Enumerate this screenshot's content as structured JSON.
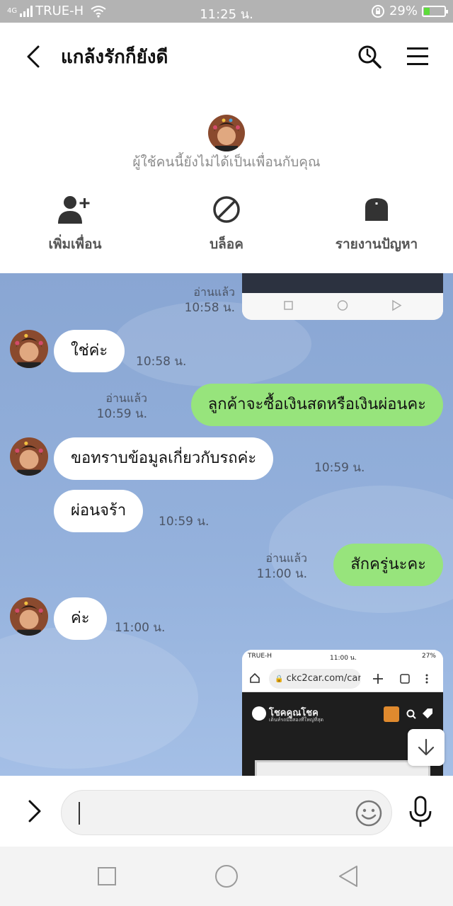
{
  "status_bar": {
    "network": "4G",
    "carrier": "TRUE-H",
    "time": "11:25 น.",
    "battery_percent": "29%",
    "battery_level": 0.29
  },
  "header": {
    "title": "แกล้งรักก็ยังดี",
    "icons": [
      "back-arrow-icon",
      "search-icon",
      "hamburger-menu-icon"
    ]
  },
  "profile": {
    "notice": "ผู้ใช้คนนี้ยังไม่ได้เป็นเพื่อนกับคุณ",
    "actions": [
      {
        "label": "เพิ่มเพื่อน",
        "icon": "add-friend-icon"
      },
      {
        "label": "บล็อค",
        "icon": "block-icon"
      },
      {
        "label": "รายงานปัญหา",
        "icon": "report-icon"
      }
    ]
  },
  "messages": [
    {
      "type": "image",
      "side": "right",
      "read": "อ่านแล้ว",
      "time": "10:58 น."
    },
    {
      "type": "text",
      "side": "left",
      "text": "ใช่ค่ะ",
      "time": "10:58 น."
    },
    {
      "type": "text",
      "side": "right",
      "text": "ลูกค้าจะซื้อเงินสดหรือเงินผ่อนคะ",
      "read": "อ่านแล้ว",
      "time": "10:59 น."
    },
    {
      "type": "text",
      "side": "left",
      "text": "ขอทราบข้อมูลเกี่ยวกับรถค่ะ",
      "time": "10:59 น."
    },
    {
      "type": "text",
      "side": "left",
      "text": "ผ่อนจร้า",
      "time": "10:59 น."
    },
    {
      "type": "text",
      "side": "right",
      "text": "สักครู่นะคะ",
      "read": "อ่านแล้ว",
      "time": "11:00 น."
    },
    {
      "type": "text",
      "side": "left",
      "text": "ค่ะ",
      "time": "11:00 น."
    },
    {
      "type": "image",
      "side": "right",
      "preview": {
        "carrier": "TRUE-H",
        "time": "11:00 น.",
        "battery": "27%",
        "url": "ckc2car.com/car",
        "site_logo": "โชคคูณโชค",
        "site_tagline": "เต็นท์รถมือสองที่ใหญ่ที่สุด"
      }
    }
  ],
  "input": {
    "value": "",
    "icons": [
      "chevron-right-icon",
      "emoji-icon",
      "microphone-icon"
    ]
  },
  "nav": [
    "recents-square-icon",
    "home-circle-icon",
    "back-triangle-icon"
  ],
  "colors": {
    "chat_bg": "#8ca9d6",
    "my_bubble": "#97e47c",
    "their_bubble": "#ffffff",
    "status_bar": "#b3b3b3"
  }
}
